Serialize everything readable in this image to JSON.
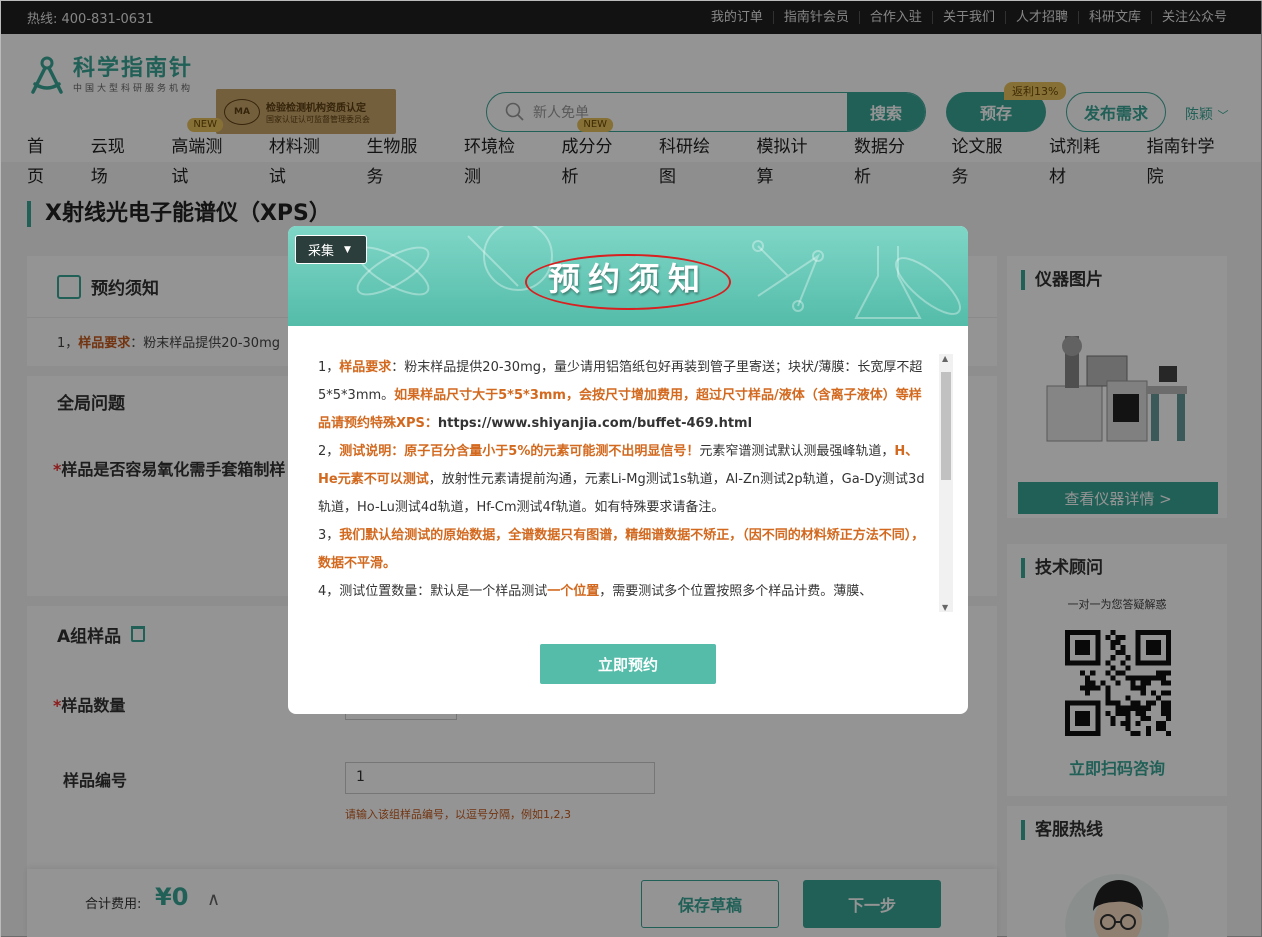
{
  "topbar": {
    "hotline": "热线: 400-831-0631",
    "links": [
      "我的订单",
      "指南针会员",
      "合作入驻",
      "关于我们",
      "人才招聘",
      "科研文库",
      "关注公众号"
    ]
  },
  "logo": {
    "name": "科学指南针",
    "tagline": "中国大型科研服务机构"
  },
  "cert": {
    "mark": "MA",
    "line1": "检验检测机构资质认定",
    "line2": "国家认证认可监督管理委员会"
  },
  "search": {
    "placeholder": "新人免单",
    "button": "搜索"
  },
  "actions": {
    "book": "预存",
    "book_badge": "返利13%",
    "publish": "发布需求",
    "user": "陈颖"
  },
  "nav": [
    {
      "label": "首页",
      "new": ""
    },
    {
      "label": "云现场",
      "new": ""
    },
    {
      "label": "高端测试",
      "new": "NEW"
    },
    {
      "label": "材料测试",
      "new": ""
    },
    {
      "label": "生物服务",
      "new": ""
    },
    {
      "label": "环境检测",
      "new": ""
    },
    {
      "label": "成分分析",
      "new": "NEW"
    },
    {
      "label": "科研绘图",
      "new": ""
    },
    {
      "label": "模拟计算",
      "new": ""
    },
    {
      "label": "数据分析",
      "new": ""
    },
    {
      "label": "论文服务",
      "new": ""
    },
    {
      "label": "试剂耗材",
      "new": ""
    },
    {
      "label": "指南针学院",
      "new": ""
    }
  ],
  "page": {
    "title": "X射线光电子能谱仪（XPS）",
    "notice_header": "预约须知",
    "notice_preview_num": "1，",
    "notice_preview_key": "样品要求",
    "notice_preview_text": "：粉末样品提供20-30mg",
    "global_header": "全局问题",
    "global_q": "样品是否容易氧化需手套箱制样",
    "group_header": "A组样品",
    "qty_label": "样品数量",
    "id_label": "样品编号",
    "id_value": "1",
    "id_hint": "请输入该组样品编号，以逗号分隔，例如1,2,3"
  },
  "footer": {
    "sum_label": "合计费用:",
    "sum": "¥0",
    "caret": "∧",
    "save": "保存草稿",
    "next": "下一步"
  },
  "sidebar": {
    "instrument": "仪器图片",
    "detail_btn": "查看仪器详情 >",
    "advisor": "技术顾问",
    "advisor_sub": "一对一为您答疑解惑",
    "scan": "立即扫码咨询",
    "service": "客服热线"
  },
  "modal": {
    "title": "预约须知",
    "collect": "采集",
    "confirm": "立即预约",
    "p1": [
      {
        "t": "1，",
        "s": ""
      },
      {
        "t": "样品要求",
        "s": "o"
      },
      {
        "t": "：粉末样品提供20-30mg，量少请用铝箔纸包好再装到管子里寄送；块状/薄膜：长宽厚不超5*5*3mm。",
        "s": ""
      },
      {
        "t": "如果样品尺寸大于5*5*3mm，会按尺寸增加费用，超过尺寸样品/液体（含离子液体）等样品请预约特殊XPS：",
        "s": "o"
      },
      {
        "t": "https://www.shiyanjia.com/buffet-469.html",
        "s": "k"
      }
    ],
    "p2": [
      {
        "t": "2，",
        "s": ""
      },
      {
        "t": "测试说明：原子百分含量小于5%的元素可能测不出明显信号！",
        "s": "o"
      },
      {
        "t": "元素窄谱测试默认测最强峰轨道，",
        "s": ""
      },
      {
        "t": "H、He元素不可以测试",
        "s": "o"
      },
      {
        "t": "，放射性元素请提前沟通，元素Li-Mg测试1s轨道，Al-Zn测试2p轨道，Ga-Dy测试3d轨道，Ho-Lu测试4d轨道，Hf-Cm测试4f轨道。如有特殊要求请备注。",
        "s": ""
      }
    ],
    "p3": [
      {
        "t": "3，",
        "s": ""
      },
      {
        "t": "我们默认给测试的原始数据，全谱数据只有图谱，精细谱数据不矫正，（因不同的材料矫正方法不同），数据不平滑。",
        "s": "o"
      }
    ],
    "p4": [
      {
        "t": "4，测试位置数量：默认是一个样品测试",
        "s": ""
      },
      {
        "t": "一个位置",
        "s": "o"
      },
      {
        "t": "，需要测试多个位置按照多个样品计费。薄膜、",
        "s": ""
      }
    ]
  }
}
